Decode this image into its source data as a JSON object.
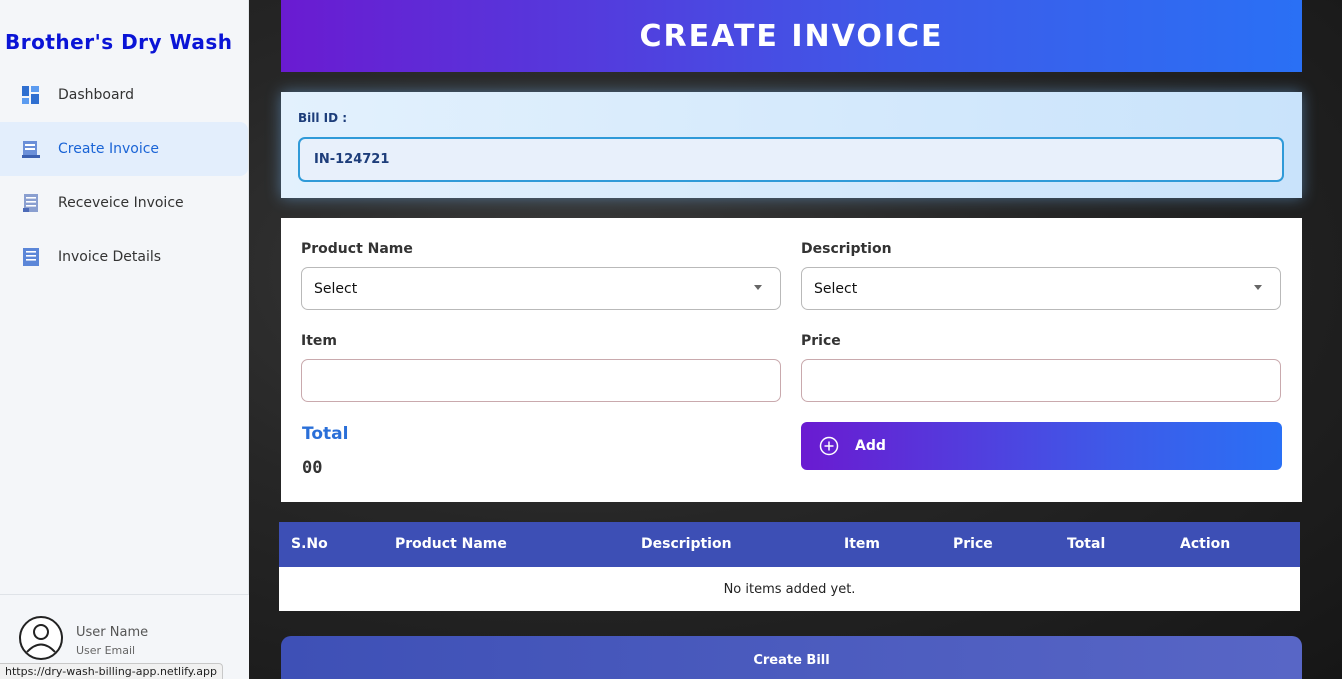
{
  "brand": "Brother's Dry Wash",
  "sidebar": {
    "items": [
      {
        "label": "Dashboard",
        "icon": "dashboard-icon"
      },
      {
        "label": "Create Invoice",
        "icon": "create-invoice-icon",
        "active": true
      },
      {
        "label": "Receveice Invoice",
        "icon": "receive-invoice-icon"
      },
      {
        "label": "Invoice Details",
        "icon": "invoice-details-icon"
      }
    ],
    "user": {
      "name": "User Name",
      "email": "User Email"
    }
  },
  "status_url": "https://dry-wash-billing-app.netlify.app",
  "header": {
    "title": "CREATE INVOICE"
  },
  "bill": {
    "label": "Bill ID :",
    "value": "IN-124721"
  },
  "form": {
    "product_name": {
      "label": "Product Name",
      "value": "Select"
    },
    "description": {
      "label": "Description",
      "value": "Select"
    },
    "item": {
      "label": "Item",
      "value": ""
    },
    "price": {
      "label": "Price",
      "value": ""
    },
    "total_label": "Total",
    "total_value": "00",
    "add_label": "Add"
  },
  "table": {
    "headers": [
      "S.No",
      "Product Name",
      "Description",
      "Item",
      "Price",
      "Total",
      "Action"
    ],
    "empty_message": "No items added yet."
  },
  "create_bill_label": "Create Bill",
  "colors": {
    "brand": "#0a14d6",
    "accent_start": "#6a1bd1",
    "accent_end": "#2a70f5",
    "table_header": "#3d4fb5",
    "active_nav": "#1a64d6"
  }
}
